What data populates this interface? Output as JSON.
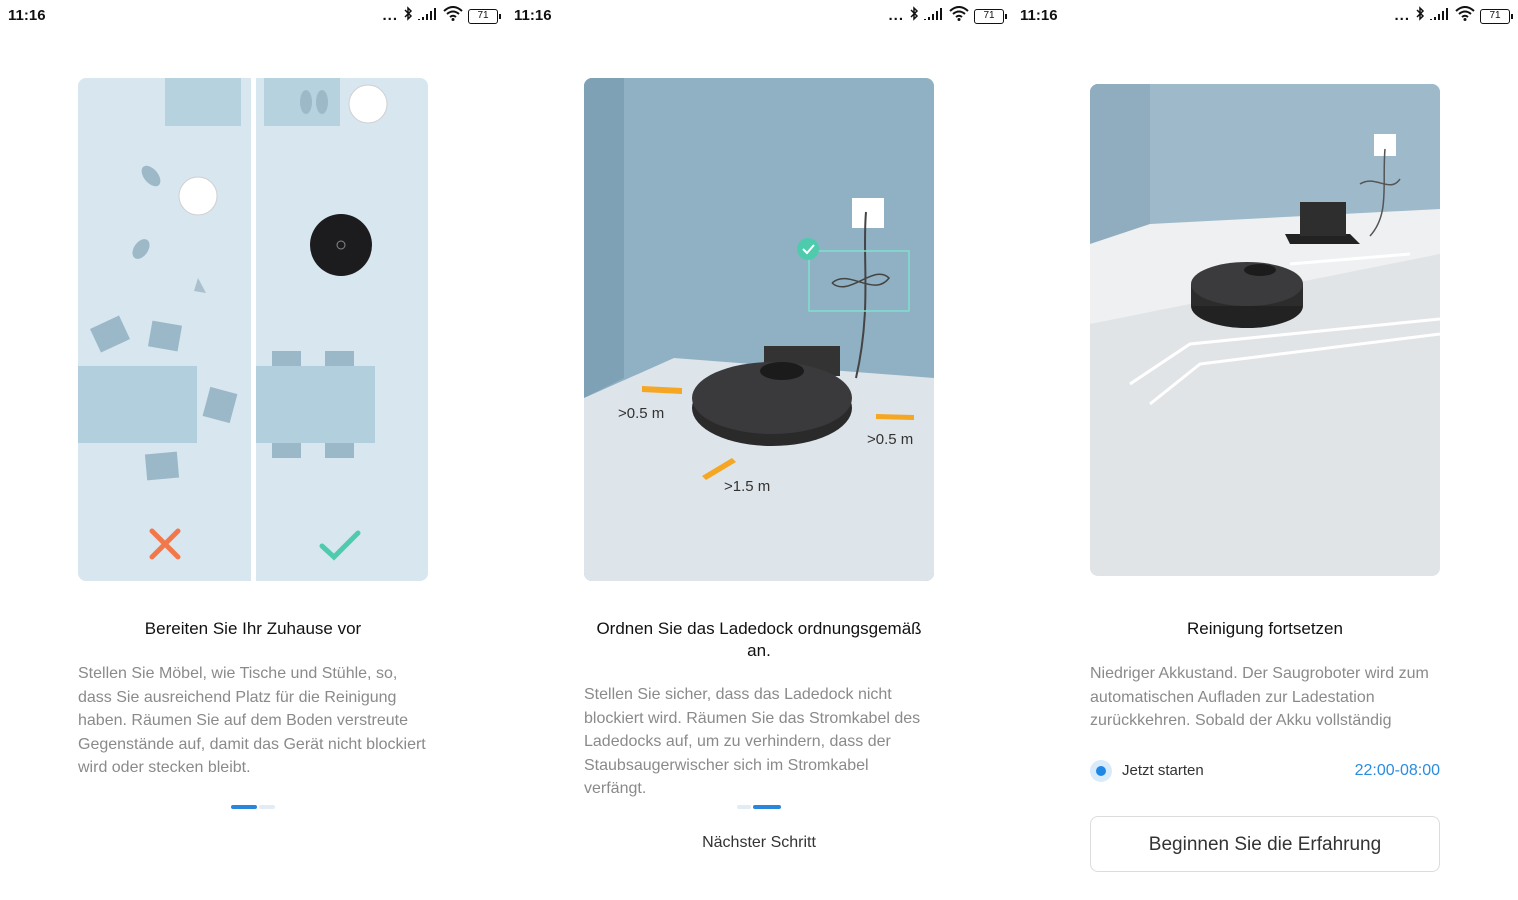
{
  "screens": [
    {
      "status": {
        "time": "11:16",
        "dots": "...",
        "battery": "71"
      },
      "title": "Bereiten Sie Ihr Zuhause vor",
      "body": "Stellen Sie Möbel, wie Tische und Stühle, so, dass Sie ausreichend Platz für die Reinigung haben. Räumen Sie auf dem Boden verstreute Gegenstände auf, damit das Gerät nicht blockiert wird oder stecken bleibt.",
      "pager": {
        "active_index": 0,
        "count": 2
      }
    },
    {
      "status": {
        "time": "11:16",
        "dots": "...",
        "battery": "71"
      },
      "title": "Ordnen Sie das Ladedock ordnungsgemäß an.",
      "body": "Stellen Sie sicher, dass das Ladedock nicht blockiert wird. Räumen Sie das Stromkabel des Ladedocks auf, um zu verhindern, dass der Staubsaugerwischer sich im Stromkabel verfängt.",
      "illustration_labels": {
        "left": ">0.5 m",
        "right": ">0.5 m",
        "front": ">1.5 m"
      },
      "pager": {
        "active_index": 1,
        "count": 2
      },
      "next_step": "Nächster Schritt"
    },
    {
      "status": {
        "time": "11:16",
        "dots": "...",
        "battery": "71"
      },
      "title": "Reinigung fortsetzen",
      "body": "Niedriger Akkustand. Der Saugroboter wird zum automatischen Aufladen zur Ladestation zurückkehren. Sobald der Akku vollständig",
      "option": {
        "label": "Jetzt starten",
        "time_range": "22:00-08:00",
        "selected": true
      },
      "start_button": "Beginnen Sie die Erfahrung"
    }
  ],
  "colors": {
    "accent_blue": "#2a8de0",
    "check_green": "#4ecbad",
    "cross_orange": "#f2784b",
    "arrow_orange": "#f5a623",
    "pager_active": "#2a86db",
    "pager_inactive": "#e4ecf3"
  }
}
